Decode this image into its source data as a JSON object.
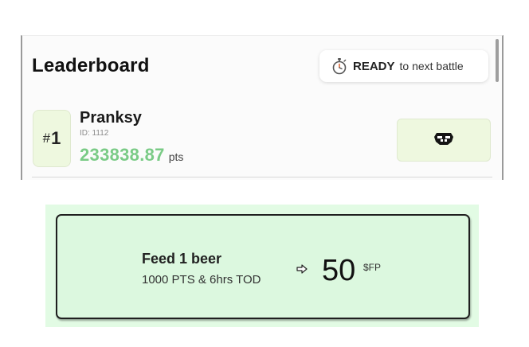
{
  "leaderboard": {
    "title": "Leaderboard",
    "status": {
      "icon": "stopwatch-icon",
      "label": "READY",
      "text": "to next battle"
    },
    "entries": [
      {
        "rank_prefix": "#",
        "rank": "1",
        "name": "Pranksy",
        "id_text": "ID: 1112",
        "points": "233838.87",
        "points_unit": "pts",
        "action_icon": "feed-bowl-icon"
      }
    ]
  },
  "promo": {
    "title": "Feed 1 beer",
    "subtitle": "1000 PTS & 6hrs TOD",
    "arrow_icon": "arrow-right-icon",
    "amount": "50",
    "currency": "$FP"
  },
  "colors": {
    "accent_green": "#7acb86",
    "badge_bg": "#eef8df",
    "promo_bg": "#dcf8df"
  }
}
